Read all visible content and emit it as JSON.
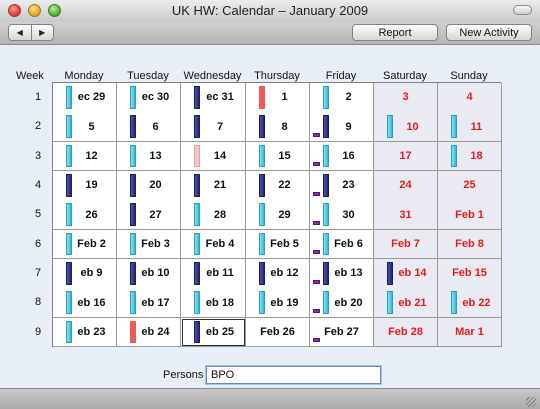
{
  "window": {
    "title": "UK HW: Calendar – January 2009"
  },
  "toolbar": {
    "back_label": "◀",
    "forward_label": "▶",
    "report_label": "Report",
    "new_activity_label": "New Activity"
  },
  "calendar": {
    "week_header": "Week",
    "day_names": [
      "Monday",
      "Tuesday",
      "Wednesday",
      "Thursday",
      "Friday",
      "Saturday",
      "Sunday"
    ],
    "week_numbers": [
      "1",
      "2",
      "3",
      "4",
      "5",
      "6",
      "7",
      "8",
      "9"
    ],
    "weeks": [
      [
        {
          "label": "ec 29",
          "bar": "cyan"
        },
        {
          "label": "ec 30",
          "bar": "cyan"
        },
        {
          "label": "ec 31",
          "bar": "navy"
        },
        {
          "label": "1",
          "bar": "red"
        },
        {
          "label": "2",
          "bar": "cyan"
        },
        {
          "label": "3",
          "bar": ""
        },
        {
          "label": "4",
          "bar": ""
        }
      ],
      [
        {
          "label": "5",
          "bar": "cyan"
        },
        {
          "label": "6",
          "bar": "navy"
        },
        {
          "label": "7",
          "bar": "navy"
        },
        {
          "label": "8",
          "bar": "navy"
        },
        {
          "label": "9",
          "bar": "navy",
          "tag": true
        },
        {
          "label": "10",
          "bar": "cyan"
        },
        {
          "label": "11",
          "bar": "cyan"
        }
      ],
      [
        {
          "label": "12",
          "bar": "cyan"
        },
        {
          "label": "13",
          "bar": "cyan"
        },
        {
          "label": "14",
          "bar": "pink"
        },
        {
          "label": "15",
          "bar": "cyan"
        },
        {
          "label": "16",
          "bar": "cyan",
          "tag": true
        },
        {
          "label": "17",
          "bar": ""
        },
        {
          "label": "18",
          "bar": "cyan"
        }
      ],
      [
        {
          "label": "19",
          "bar": "navy"
        },
        {
          "label": "20",
          "bar": "navy"
        },
        {
          "label": "21",
          "bar": "navy"
        },
        {
          "label": "22",
          "bar": "navy"
        },
        {
          "label": "23",
          "bar": "navy",
          "tag": true
        },
        {
          "label": "24",
          "bar": ""
        },
        {
          "label": "25",
          "bar": ""
        }
      ],
      [
        {
          "label": "26",
          "bar": "cyan"
        },
        {
          "label": "27",
          "bar": "navy"
        },
        {
          "label": "28",
          "bar": "cyan"
        },
        {
          "label": "29",
          "bar": "cyan"
        },
        {
          "label": "30",
          "bar": "cyan",
          "tag": true
        },
        {
          "label": "31",
          "bar": ""
        },
        {
          "label": "Feb 1",
          "bar": ""
        }
      ],
      [
        {
          "label": "Feb 2",
          "bar": "cyan"
        },
        {
          "label": "Feb 3",
          "bar": "cyan"
        },
        {
          "label": "Feb 4",
          "bar": "cyan"
        },
        {
          "label": "Feb 5",
          "bar": "cyan"
        },
        {
          "label": "Feb 6",
          "bar": "cyan",
          "tag": true
        },
        {
          "label": "Feb 7",
          "bar": ""
        },
        {
          "label": "Feb 8",
          "bar": ""
        }
      ],
      [
        {
          "label": "eb 9",
          "bar": "navy"
        },
        {
          "label": "eb 10",
          "bar": "navy"
        },
        {
          "label": "eb 11",
          "bar": "navy"
        },
        {
          "label": "eb 12",
          "bar": "navy"
        },
        {
          "label": "eb 13",
          "bar": "navy",
          "tag": true
        },
        {
          "label": "eb 14",
          "bar": "navy"
        },
        {
          "label": "Feb 15",
          "bar": ""
        }
      ],
      [
        {
          "label": "eb 16",
          "bar": "cyan"
        },
        {
          "label": "eb 17",
          "bar": "cyan"
        },
        {
          "label": "eb 18",
          "bar": "cyan"
        },
        {
          "label": "eb 19",
          "bar": "cyan"
        },
        {
          "label": "eb 20",
          "bar": "cyan",
          "tag": true
        },
        {
          "label": "eb 21",
          "bar": "cyan"
        },
        {
          "label": "eb 22",
          "bar": "cyan"
        }
      ],
      [
        {
          "label": "eb 23",
          "bar": "cyan"
        },
        {
          "label": "eb 24",
          "bar": "red"
        },
        {
          "label": "eb 25",
          "bar": "navy",
          "selected": true
        },
        {
          "label": "Feb 26",
          "bar": ""
        },
        {
          "label": "Feb 27",
          "bar": "",
          "tag": true
        },
        {
          "label": "Feb 28",
          "bar": ""
        },
        {
          "label": "Mar 1",
          "bar": ""
        }
      ]
    ]
  },
  "filter": {
    "persons_label": "Persons",
    "persons_value": "BPO"
  },
  "colors": {
    "weekend_text": "#e21b1b",
    "bar_cyan": "#36b8d1",
    "bar_navy": "#24286e",
    "bar_red": "#ee5a5a",
    "bar_pink": "#f7c0c6",
    "tag_purple": "#8a2da4"
  }
}
